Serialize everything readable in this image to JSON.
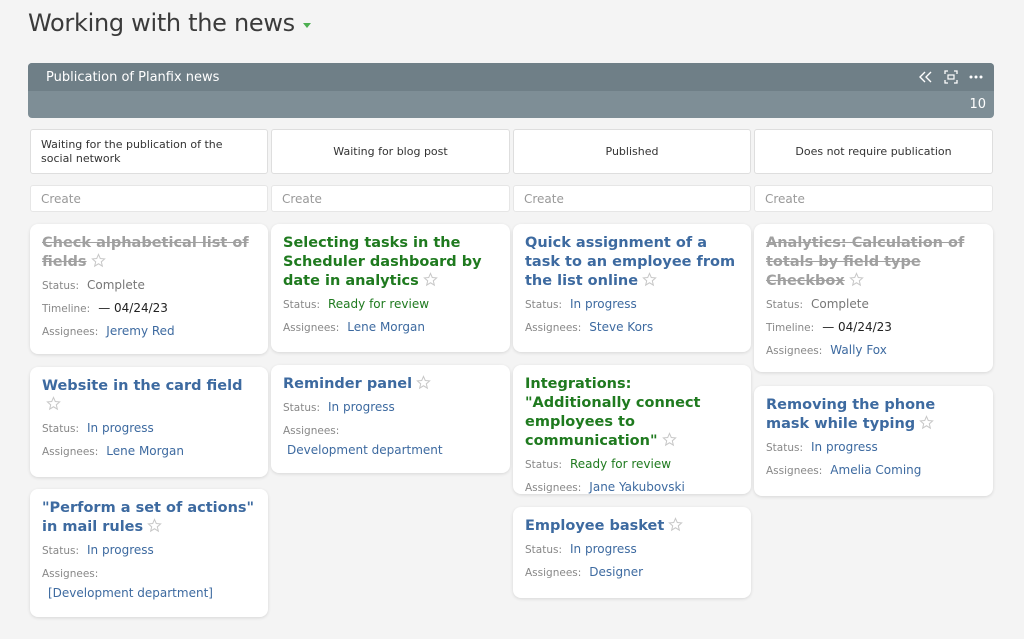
{
  "page": {
    "title": "Working with the news"
  },
  "board": {
    "name": "Publication of Planfix news",
    "count": "10"
  },
  "create_label": "Create",
  "labels": {
    "status": "Status:",
    "timeline": "Timeline:",
    "assignees": "Assignees:"
  },
  "columns": [
    {
      "title": "Waiting for the publication of the social network"
    },
    {
      "title": "Waiting for blog post"
    },
    {
      "title": "Published"
    },
    {
      "title": "Does not require publication"
    }
  ],
  "cards": {
    "c1": {
      "title": "Check alphabetical list of fields",
      "status": "Complete",
      "timeline": "— 04/24/23",
      "assignees": "Jeremy Red"
    },
    "c2": {
      "title": "Website in the card field",
      "status": "In progress",
      "assignees": "Lene Morgan"
    },
    "c3": {
      "title": "\"Perform a set of actions\" in mail rules",
      "status": "In progress",
      "assignees": "[Development department]"
    },
    "c4": {
      "title": "Selecting tasks in the Scheduler dashboard by date in analytics",
      "status": "Ready for review",
      "assignees": "Lene Morgan"
    },
    "c5": {
      "title": "Reminder panel",
      "status": "In progress",
      "assignees": "Development department"
    },
    "c6": {
      "title": "Quick assignment of a task to an employee from the list online",
      "status": "In progress",
      "assignees": "Steve Kors"
    },
    "c7": {
      "title": "Integrations: \"Additionally connect employees to communication\"",
      "status": "Ready for review",
      "assignees": "Jane Yakubovski"
    },
    "c8": {
      "title": "Employee basket",
      "status": "In progress",
      "assignees": "Designer"
    },
    "c9": {
      "title": "Analytics: Calculation of totals by field type Checkbox",
      "status": "Complete",
      "timeline": "— 04/24/23",
      "assignees": "Wally Fox"
    },
    "c10": {
      "title": "Removing the phone mask while typing",
      "status": "In progress",
      "assignees": "Amelia Coming"
    }
  },
  "icons": {
    "collapse": "double-chevron-left-icon",
    "focus": "focus-frame-icon",
    "more": "more-dots-icon",
    "star": "star-outline-icon",
    "dropdown": "caret-down-icon"
  },
  "colors": {
    "link": "#3d6aa0",
    "review": "#1f7a1f",
    "header": "#7e8e96",
    "caret": "#4caf50"
  }
}
